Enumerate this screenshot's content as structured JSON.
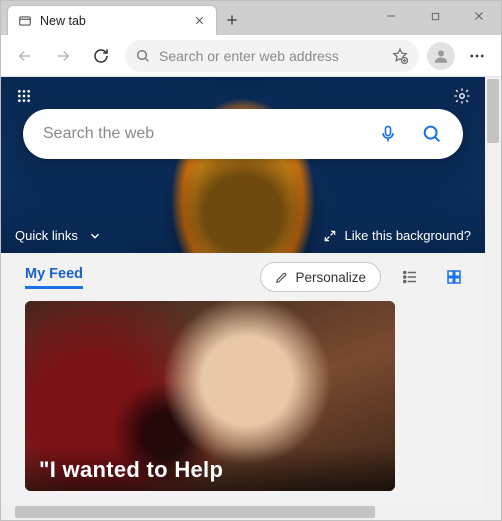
{
  "tab": {
    "title": "New tab"
  },
  "addressbar": {
    "placeholder": "Search or enter web address"
  },
  "hero": {
    "search_placeholder": "Search the web",
    "quicklinks_label": "Quick links",
    "like_bg_label": "Like this background?"
  },
  "feed": {
    "tab_label": "My Feed",
    "personalize_label": "Personalize"
  },
  "card": {
    "headline": "\"I wanted to Help"
  }
}
